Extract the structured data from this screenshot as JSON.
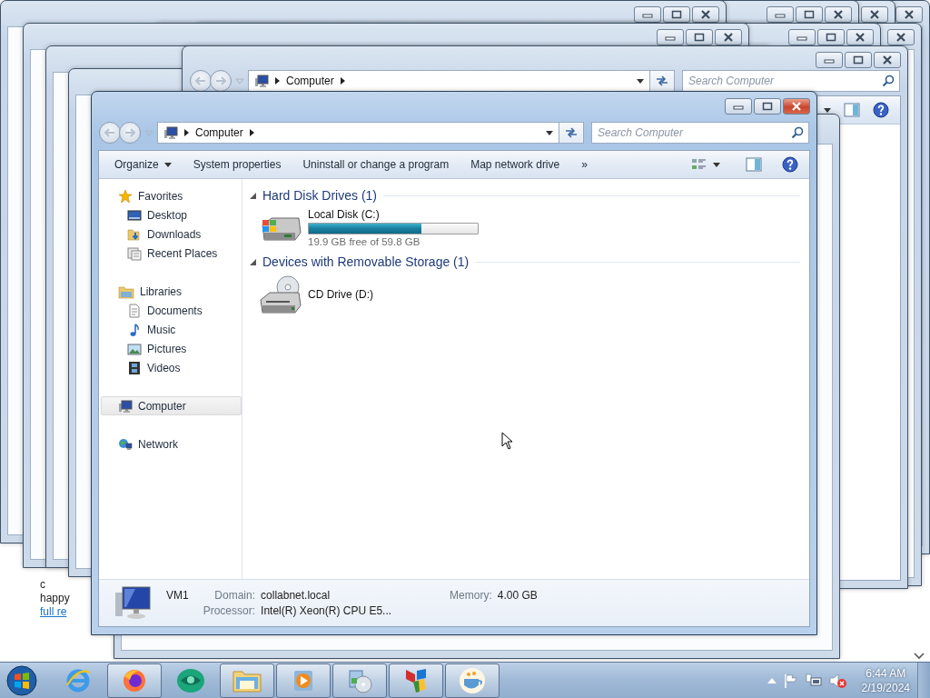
{
  "background_page": {
    "lines": [
      "c",
      "happy"
    ],
    "link": "full re"
  },
  "background_window": {
    "address": "Computer",
    "search_placeholder": "Search Computer"
  },
  "window": {
    "nav_buttons": [
      {
        "kind": "back",
        "disabled": true
      },
      {
        "kind": "forward",
        "disabled": true
      }
    ],
    "address": "Computer",
    "search_placeholder": "Search Computer",
    "toolbar": [
      {
        "label": "Organize",
        "dropdown": true
      },
      {
        "label": "System properties",
        "dropdown": false
      },
      {
        "label": "Uninstall or change a program",
        "dropdown": false
      },
      {
        "label": "Map network drive",
        "dropdown": false
      },
      {
        "label": "»",
        "dropdown": false
      }
    ],
    "nav": [
      {
        "label": "Favorites",
        "kind": "star",
        "selected": false,
        "children": [
          {
            "label": "Desktop",
            "kind": "desktop",
            "selected": false
          },
          {
            "label": "Downloads",
            "kind": "downloads",
            "selected": false
          },
          {
            "label": "Recent Places",
            "kind": "recent",
            "selected": false
          }
        ]
      },
      {
        "label": "Libraries",
        "kind": "libraries",
        "selected": false,
        "children": [
          {
            "label": "Documents",
            "kind": "document",
            "selected": false
          },
          {
            "label": "Music",
            "kind": "music",
            "selected": false
          },
          {
            "label": "Pictures",
            "kind": "pictures",
            "selected": false
          },
          {
            "label": "Videos",
            "kind": "videos",
            "selected": false
          }
        ]
      },
      {
        "label": "Computer",
        "kind": "computer",
        "selected": true
      },
      {
        "label": "Network",
        "kind": "network",
        "selected": false
      }
    ],
    "sections": [
      {
        "title": "Hard Disk Drives (1)",
        "expanded": true,
        "items": [
          {
            "name": "Local Disk (C:)",
            "kind": "disk",
            "level": 0.667,
            "free": "19.9 GB free of 59.8 GB"
          }
        ]
      },
      {
        "title": "Devices with Removable Storage (1)",
        "expanded": true,
        "items": [
          {
            "name": "CD Drive (D:)",
            "kind": "cd"
          }
        ]
      }
    ],
    "details": {
      "name": "VM1",
      "fields": [
        {
          "label": "Domain:",
          "value": "collabnet.local"
        },
        {
          "label": "Memory:",
          "value": "4.00 GB"
        },
        {
          "label": "Processor:",
          "value": "Intel(R) Xeon(R) CPU E5..."
        }
      ]
    }
  },
  "taskbar": {
    "apps": [
      {
        "kind": "ie",
        "running": false
      },
      {
        "kind": "firefox",
        "running": true
      },
      {
        "kind": "globe",
        "running": false
      },
      {
        "kind": "explorer",
        "running": true
      },
      {
        "kind": "media",
        "running": true
      },
      {
        "kind": "disc",
        "running": true
      },
      {
        "kind": "update",
        "running": true
      },
      {
        "kind": "cup",
        "running": true
      }
    ],
    "tray": [
      {
        "kind": "expand"
      },
      {
        "kind": "flag"
      },
      {
        "kind": "network"
      },
      {
        "kind": "volume",
        "muted": true
      }
    ],
    "time": "6:44 AM",
    "date": "2/19/2024"
  }
}
